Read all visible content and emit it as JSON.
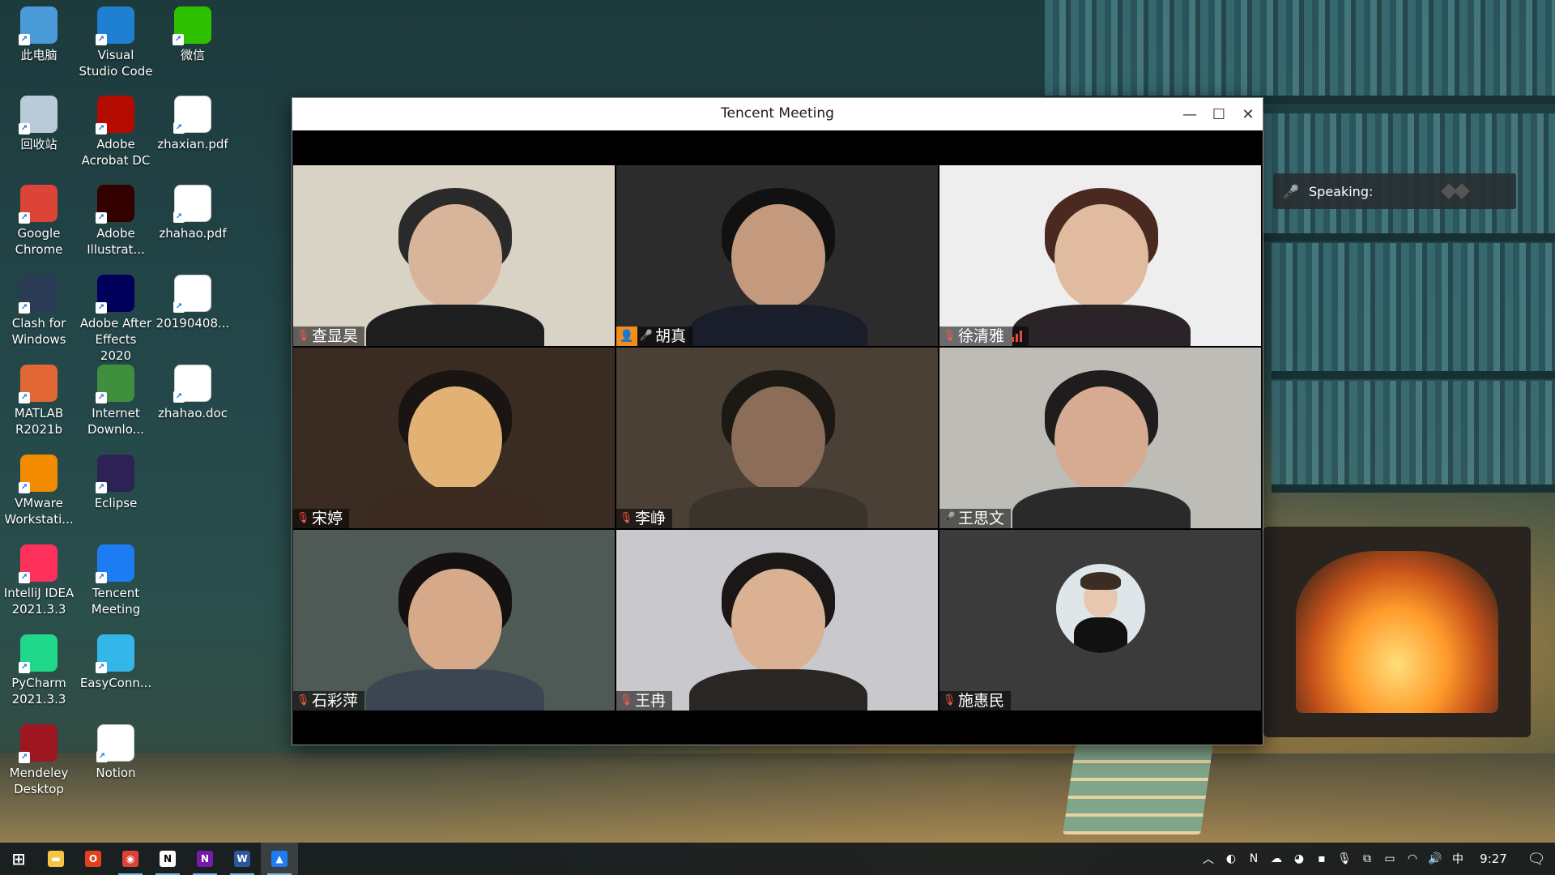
{
  "desktop": {
    "icons": [
      {
        "label": "此电脑",
        "icon": "computer-icon",
        "color": "#4a9bd8"
      },
      {
        "label": "Visual Studio Code",
        "icon": "vscode-icon",
        "color": "#1f7fd1"
      },
      {
        "label": "微信",
        "icon": "wechat-icon",
        "color": "#2dc100"
      },
      {
        "label": "回收站",
        "icon": "recycle-bin-icon",
        "color": "#b9cbd8"
      },
      {
        "label": "Adobe Acrobat DC",
        "icon": "acrobat-icon",
        "color": "#b30b00"
      },
      {
        "label": "zhaxian.pdf",
        "icon": "pdf-file-icon",
        "color": "#ffffff"
      },
      {
        "label": "Google Chrome",
        "icon": "chrome-icon",
        "color": "#db4437"
      },
      {
        "label": "Adobe Illustrat...",
        "icon": "illustrator-icon",
        "color": "#330000"
      },
      {
        "label": "zhahao.pdf",
        "icon": "pdf-file-icon",
        "color": "#ffffff"
      },
      {
        "label": "Clash for Windows",
        "icon": "clash-icon",
        "color": "#2b3a55"
      },
      {
        "label": "Adobe After Effects 2020",
        "icon": "after-effects-icon",
        "color": "#00005b"
      },
      {
        "label": "20190408...",
        "icon": "word-doc-icon",
        "color": "#ffffff"
      },
      {
        "label": "MATLAB R2021b",
        "icon": "matlab-icon",
        "color": "#e16737"
      },
      {
        "label": "Internet Downlo...",
        "icon": "idm-icon",
        "color": "#3f8f3f"
      },
      {
        "label": "zhahao.doc",
        "icon": "word-doc-icon",
        "color": "#ffffff"
      },
      {
        "label": "VMware Workstati...",
        "icon": "vmware-icon",
        "color": "#f38b00"
      },
      {
        "label": "Eclipse",
        "icon": "eclipse-icon",
        "color": "#2c2255"
      },
      {
        "label": "IntelliJ IDEA 2021.3.3",
        "icon": "intellij-icon",
        "color": "#fe315d"
      },
      {
        "label": "Tencent Meeting",
        "icon": "tencent-meeting-icon",
        "color": "#1e7cf2"
      },
      {
        "label": "PyCharm 2021.3.3",
        "icon": "pycharm-icon",
        "color": "#21d789"
      },
      {
        "label": "EasyConn...",
        "icon": "easyconnect-icon",
        "color": "#35b6e8"
      },
      {
        "label": "Mendeley Desktop",
        "icon": "mendeley-icon",
        "color": "#9d1620"
      },
      {
        "label": "Notion",
        "icon": "notion-icon",
        "color": "#ffffff"
      }
    ]
  },
  "window": {
    "title": "Tencent Meeting",
    "minimize": "—",
    "maximize": "☐",
    "close": "✕"
  },
  "participants": [
    {
      "name": "查显昊",
      "muted": true,
      "host": false,
      "signal": false,
      "bg": "#d9d3c6",
      "skin": "#d8b49a",
      "hair": "#2a2a2a",
      "shirt": "#1e1e1e"
    },
    {
      "name": "胡真",
      "muted": false,
      "host": true,
      "signal": false,
      "bg": "#2c2c2c",
      "skin": "#c49a7e",
      "hair": "#111111",
      "shirt": "#1a1d2a"
    },
    {
      "name": "徐清雅",
      "muted": true,
      "host": false,
      "signal": true,
      "bg": "#eeeeee",
      "skin": "#e0bba0",
      "hair": "#4a2a20",
      "shirt": "#2a2428"
    },
    {
      "name": "宋婷",
      "muted": true,
      "host": false,
      "signal": false,
      "bg": "#3a2c22",
      "skin": "#e2b274",
      "hair": "#1a1412",
      "shirt": "#3a2a20"
    },
    {
      "name": "李峥",
      "muted": true,
      "host": false,
      "signal": false,
      "bg": "#4a4036",
      "skin": "#8c6e58",
      "hair": "#1c1814",
      "shirt": "#3a342c"
    },
    {
      "name": "王思文",
      "muted": false,
      "host": false,
      "signal": false,
      "bg": "#bdbcb6",
      "skin": "#d7aa92",
      "hair": "#1e1c1c",
      "shirt": "#2a2a2a"
    },
    {
      "name": "石彩萍",
      "muted": true,
      "host": false,
      "signal": false,
      "bg": "#4f5a56",
      "skin": "#d6a98a",
      "hair": "#141110",
      "shirt": "#3c4652"
    },
    {
      "name": "王冉",
      "muted": true,
      "host": false,
      "signal": false,
      "bg": "#c9c8cc",
      "skin": "#dab293",
      "hair": "#1a1716",
      "shirt": "#2a2624"
    },
    {
      "name": "施惠民",
      "muted": true,
      "host": false,
      "signal": false,
      "bg": "#3b3b3b",
      "skin": "#e8c7b0",
      "hair": "#3b2d24",
      "shirt": "#111111",
      "avatar_only": true
    }
  ],
  "speaking_indicator": {
    "label": "Speaking:"
  },
  "taskbar": {
    "apps": [
      {
        "icon": "windows-start-icon",
        "color": "#ffffff",
        "running": false,
        "active": false,
        "glyph": "⊞"
      },
      {
        "icon": "file-explorer-icon",
        "color": "#f5c542",
        "running": false,
        "active": false,
        "glyph": "▬"
      },
      {
        "icon": "office-icon",
        "color": "#e3401b",
        "running": false,
        "active": false,
        "glyph": "O"
      },
      {
        "icon": "chrome-icon",
        "color": "#db4437",
        "running": true,
        "active": false,
        "glyph": "◉"
      },
      {
        "icon": "notion-icon",
        "color": "#ffffff",
        "running": true,
        "active": false,
        "glyph": "N"
      },
      {
        "icon": "onenote-icon",
        "color": "#7719aa",
        "running": true,
        "active": false,
        "glyph": "N"
      },
      {
        "icon": "word-icon",
        "color": "#2b579a",
        "running": true,
        "active": false,
        "glyph": "W"
      },
      {
        "icon": "tencent-meeting-icon",
        "color": "#1e7cf2",
        "running": true,
        "active": true,
        "glyph": "▲"
      }
    ],
    "tray": [
      {
        "icon": "chevron-up-icon",
        "glyph": "︿"
      },
      {
        "icon": "qq-icon",
        "glyph": "◐"
      },
      {
        "icon": "onenote-tray-icon",
        "glyph": "N"
      },
      {
        "icon": "cloud-icon",
        "glyph": "☁"
      },
      {
        "icon": "colorful-app-icon",
        "glyph": "◕"
      },
      {
        "icon": "clash-tray-icon",
        "glyph": "▪"
      },
      {
        "icon": "microphone-icon",
        "glyph": "🎙"
      },
      {
        "icon": "screen-record-icon",
        "glyph": "⧉"
      },
      {
        "icon": "battery-icon",
        "glyph": "▭"
      },
      {
        "icon": "wifi-icon",
        "glyph": "◠"
      },
      {
        "icon": "volume-icon",
        "glyph": "🔊"
      }
    ],
    "ime": "中",
    "time": "9:27",
    "notification_icon": "notification-icon"
  }
}
